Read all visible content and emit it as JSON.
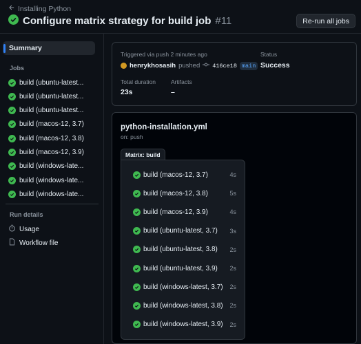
{
  "header": {
    "back_label": "Installing Python",
    "title": "Configure matrix strategy for build job",
    "run_number": "#11",
    "rerun_label": "Re-run all jobs"
  },
  "sidebar": {
    "summary_label": "Summary",
    "jobs_heading": "Jobs",
    "jobs": [
      {
        "label": "build (ubuntu-latest, 3.7)",
        "display": "build (ubuntu-latest..."
      },
      {
        "label": "build (ubuntu-latest, 3.8)",
        "display": "build (ubuntu-latest..."
      },
      {
        "label": "build (ubuntu-latest, 3.9)",
        "display": "build (ubuntu-latest..."
      },
      {
        "label": "build (macos-12, 3.7)",
        "display": "build (macos-12, 3.7)"
      },
      {
        "label": "build (macos-12, 3.8)",
        "display": "build (macos-12, 3.8)"
      },
      {
        "label": "build (macos-12, 3.9)",
        "display": "build (macos-12, 3.9)"
      },
      {
        "label": "build (windows-latest, 3.7)",
        "display": "build (windows-late..."
      },
      {
        "label": "build (windows-latest, 3.8)",
        "display": "build (windows-late..."
      },
      {
        "label": "build (windows-latest, 3.9)",
        "display": "build (windows-late..."
      }
    ],
    "run_details_heading": "Run details",
    "usage_label": "Usage",
    "workflow_file_label": "Workflow file"
  },
  "summary_card": {
    "triggered_text": "Triggered via push 2 minutes ago",
    "user": "henrykhosasih",
    "pushed_text": "pushed",
    "commit_sha": "416ce18",
    "branch": "main",
    "status_label": "Status",
    "status_value": "Success",
    "duration_label": "Total duration",
    "duration_value": "23s",
    "artifacts_label": "Artifacts",
    "artifacts_value": "–"
  },
  "workflow": {
    "file_name": "python-installation.yml",
    "trigger": "on: push",
    "matrix_label": "Matrix: build",
    "jobs": [
      {
        "label": "build (macos-12, 3.7)",
        "duration": "4s"
      },
      {
        "label": "build (macos-12, 3.8)",
        "duration": "5s"
      },
      {
        "label": "build (macos-12, 3.9)",
        "duration": "4s"
      },
      {
        "label": "build (ubuntu-latest, 3.7)",
        "duration": "3s"
      },
      {
        "label": "build (ubuntu-latest, 3.8)",
        "duration": "2s"
      },
      {
        "label": "build (ubuntu-latest, 3.9)",
        "duration": "2s"
      },
      {
        "label": "build (windows-latest, 3.7)",
        "duration": "2s"
      },
      {
        "label": "build (windows-latest, 3.8)",
        "duration": "2s"
      },
      {
        "label": "build (windows-latest, 3.9)",
        "duration": "2s"
      }
    ]
  },
  "colors": {
    "background": "#0d1117",
    "success": "#3fb950",
    "accent": "#2f81f7",
    "muted_text": "#8b949e",
    "border": "#30363d"
  },
  "icons": {
    "back": "arrow-left-icon",
    "status": "check-circle-icon",
    "usage": "stopwatch-icon",
    "workflow_file": "file-icon",
    "commit": "git-commit-icon"
  }
}
